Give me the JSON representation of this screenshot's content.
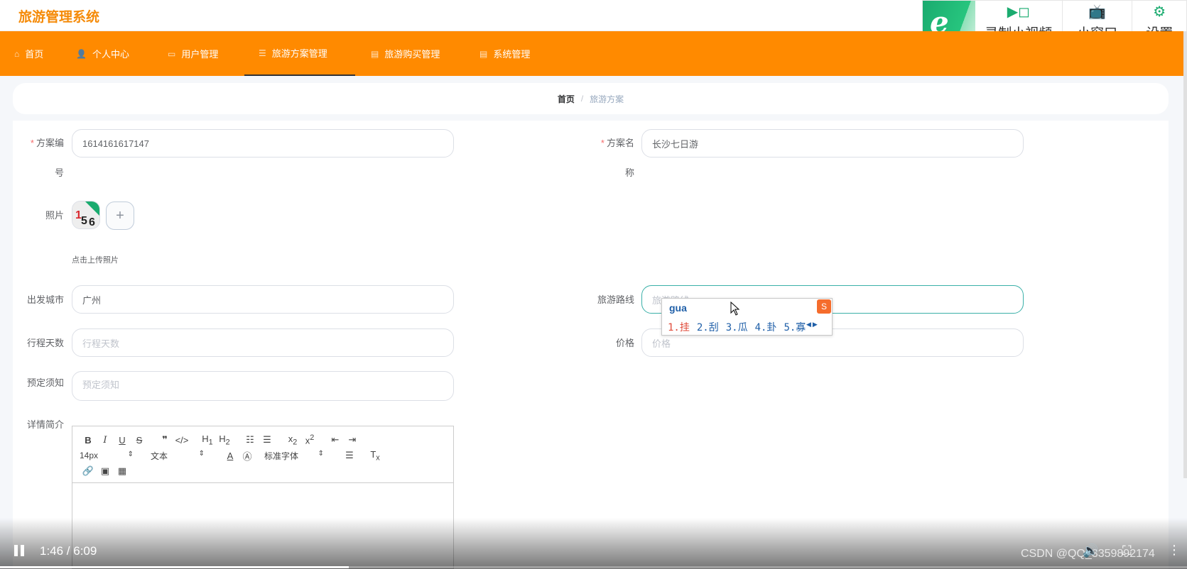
{
  "app": {
    "title": "旅游管理系统"
  },
  "tools": {
    "record_label": "录制小视频",
    "mini_label": "小窗口",
    "settings_label": "设置"
  },
  "nav": [
    {
      "label": "首页",
      "icon": "home-icon"
    },
    {
      "label": "个人中心",
      "icon": "user-icon"
    },
    {
      "label": "用户管理",
      "icon": "chat-icon"
    },
    {
      "label": "旅游方案管理",
      "icon": "list-icon"
    },
    {
      "label": "旅游购买管理",
      "icon": "doc-icon"
    },
    {
      "label": "系统管理",
      "icon": "doc-icon"
    }
  ],
  "breadcrumb": {
    "home": "首页",
    "separator": "/",
    "current": "旅游方案"
  },
  "form": {
    "plan_no": {
      "label_a": "方案编",
      "label_b": "号",
      "value": "1614161617147"
    },
    "plan_name": {
      "label_a": "方案名",
      "label_b": "称",
      "value": "长沙七日游"
    },
    "photo": {
      "label": "照片",
      "upload_tip": "点击上传照片"
    },
    "departure": {
      "label": "出发城市",
      "value": "广州"
    },
    "route": {
      "label": "旅游路线",
      "placeholder": "旅游路线"
    },
    "days": {
      "label": "行程天数",
      "placeholder": "行程天数"
    },
    "price": {
      "label": "价格",
      "placeholder": "价格"
    },
    "notice": {
      "label": "预定须知",
      "placeholder": "预定须知"
    },
    "detail": {
      "label": "详情简介"
    }
  },
  "ime": {
    "pinyin": "gua",
    "candidates": [
      "1.挂",
      "2.刮",
      "3.瓜",
      "4.卦",
      "5.寡"
    ]
  },
  "editor": {
    "font_size": "14px",
    "block_type": "文本",
    "font_family": "标准字体"
  },
  "video": {
    "time": "1:46 / 6:09",
    "progress": 0.294
  },
  "watermark": "CSDN @QQ_3359892174",
  "colors": {
    "accent": "#ff8a00",
    "title": "#f58a07",
    "focus": "#3ab0a8"
  }
}
